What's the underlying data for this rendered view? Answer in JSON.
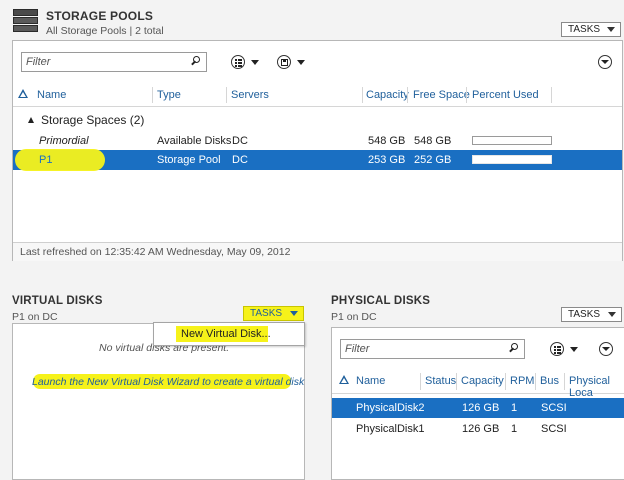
{
  "storage_pools": {
    "title": "STORAGE POOLS",
    "subtitle": "All Storage Pools | 2 total",
    "tasks_label": "TASKS",
    "filter_placeholder": "Filter",
    "columns": [
      "Name",
      "Type",
      "Servers",
      "Capacity",
      "Free Space",
      "Percent Used"
    ],
    "group_label": "Storage Spaces (2)",
    "rows": [
      {
        "name": "Primordial",
        "type": "Available Disks",
        "servers": "DC",
        "capacity": "548 GB",
        "free": "548 GB",
        "percent_used": 0
      },
      {
        "name": "P1",
        "type": "Storage Pool",
        "servers": "DC",
        "capacity": "253 GB",
        "free": "252 GB",
        "percent_used": 0
      }
    ],
    "status": "Last refreshed on 12:35:42 AM Wednesday, May 09, 2012"
  },
  "virtual_disks": {
    "title": "VIRTUAL DISKS",
    "subtitle": "P1 on DC",
    "tasks_label": "TASKS",
    "menu_item": "New Virtual Disk...",
    "empty_text": "No virtual disks are present.",
    "wizard_link": "Launch the New Virtual Disk Wizard to create a virtual disk"
  },
  "physical_disks": {
    "title": "PHYSICAL DISKS",
    "subtitle": "P1 on DC",
    "tasks_label": "TASKS",
    "filter_placeholder": "Filter",
    "columns": [
      "Name",
      "Status",
      "Capacity",
      "RPM",
      "Bus",
      "Physical Loca"
    ],
    "rows": [
      {
        "name": "PhysicalDisk2",
        "status": "",
        "capacity": "126 GB",
        "rpm": "1",
        "bus": "SCSI"
      },
      {
        "name": "PhysicalDisk1",
        "status": "",
        "capacity": "126 GB",
        "rpm": "1",
        "bus": "SCSI"
      }
    ]
  },
  "colors": {
    "selection": "#1a6fc2",
    "header_text": "#1f5f9b",
    "highlight": "#f6f21a"
  }
}
